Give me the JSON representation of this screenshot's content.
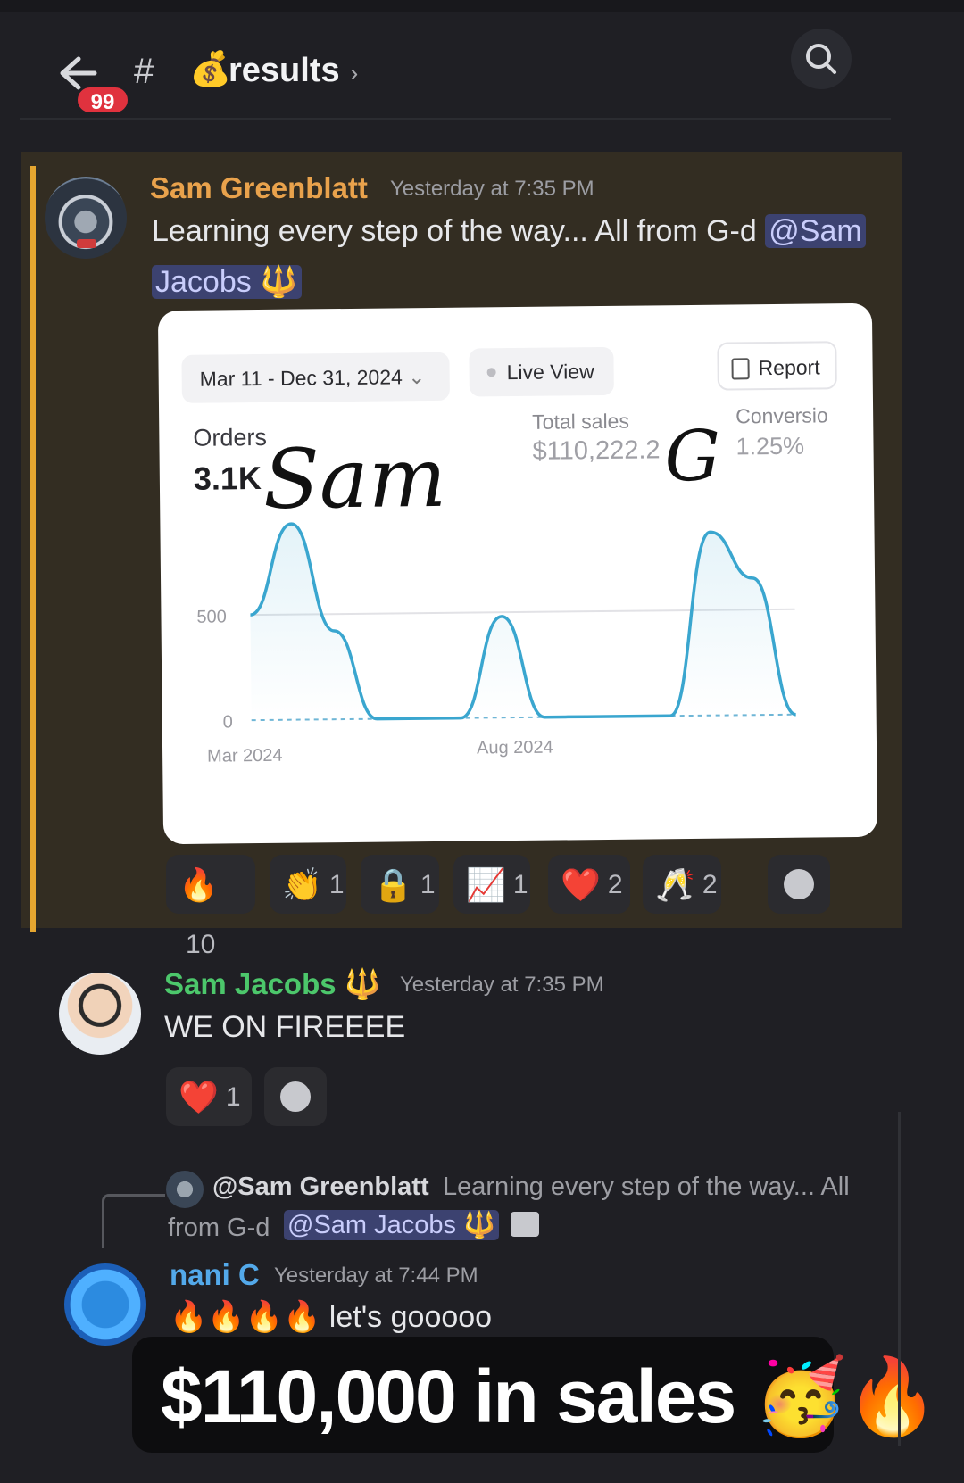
{
  "header": {
    "unread_badge": "99",
    "hash": "#",
    "channel_emoji": "💰",
    "channel_name": "results",
    "chevron": "›",
    "search_icon": "search-icon"
  },
  "messages": [
    {
      "author": "Sam Greenblatt",
      "time": "Yesterday at 7:35 PM",
      "text_line1": "Learning every step of the way... All from G-d",
      "mention_part1": "@Sam",
      "mention_part2": "Jacobs 🔱",
      "author_color": "#e9a24c",
      "embed": {
        "date_range": "Mar 11 - Dec 31, 2024",
        "date_chevron": "⌄",
        "live_view": "Live View",
        "report": "Report",
        "orders_label": "Orders",
        "orders_value": "3.1K",
        "total_sales_label": "Total sales",
        "total_sales_value": "$110,222.2",
        "conversion_label": "Conversio",
        "conversion_value": "1.25%",
        "handwriting_1": "Sam",
        "handwriting_2": "G",
        "chart_data": {
          "type": "line",
          "y_ticks": [
            "500",
            "0"
          ],
          "x_ticks": [
            "Mar 2024",
            "Aug 2024"
          ],
          "ylim": [
            0,
            1000
          ],
          "series": [
            {
              "values": [
                500,
                930,
                420,
                0,
                0,
                0,
                480,
                0,
                0,
                0,
                0,
                870,
                650,
                0
              ]
            }
          ]
        }
      },
      "reactions": [
        {
          "emoji": "🔥",
          "count": "10"
        },
        {
          "emoji": "👏",
          "count": "1"
        },
        {
          "emoji": "🔒",
          "count": "1"
        },
        {
          "emoji": "📈",
          "count": "1"
        },
        {
          "emoji": "❤️",
          "count": "2"
        },
        {
          "emoji": "🥂",
          "count": "2"
        }
      ]
    },
    {
      "author": "Sam Jacobs 🔱",
      "time": "Yesterday at 7:35 PM",
      "text": "WE ON FIREEEE",
      "author_color": "#4cc76b",
      "reactions": [
        {
          "emoji": "❤️",
          "count": "1"
        }
      ]
    },
    {
      "reply": {
        "name": "@Sam Greenblatt",
        "text1": "Learning every step of the way... All",
        "text2": "from G-d",
        "mention": "@Sam Jacobs 🔱"
      },
      "author": "nani C",
      "time": "Yesterday at 7:44 PM",
      "text": "🔥🔥🔥🔥 let's gooooo",
      "author_color": "#53a9ea"
    }
  ],
  "caption": "$110,000 in sales 🥳🔥"
}
